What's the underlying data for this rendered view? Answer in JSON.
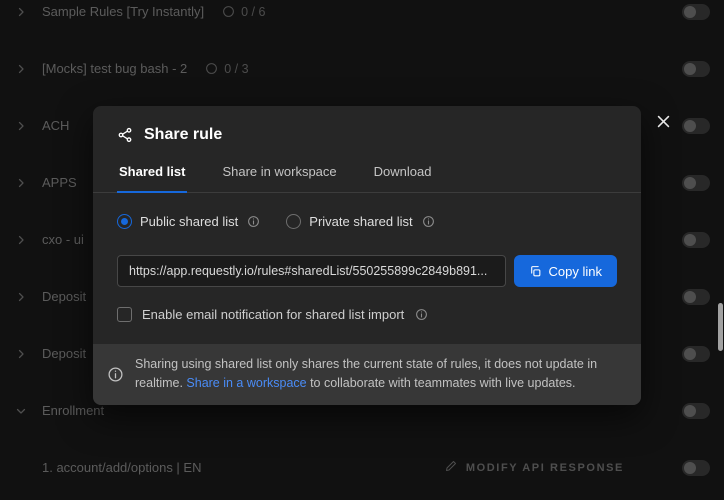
{
  "colors": {
    "accent_blue": "#1668dc",
    "link_blue": "#4a8cf7",
    "modal_bg": "#262626",
    "footer_bg": "#373737"
  },
  "rules_list": {
    "rows": [
      {
        "name": "Sample Rules [Try Instantly]",
        "count": "0 / 6"
      },
      {
        "name": "[Mocks] test bug bash - 2",
        "count": "0 / 3"
      },
      {
        "name": "ACH"
      },
      {
        "name": "APPS"
      },
      {
        "name": "cxo - ui"
      },
      {
        "name": "Deposit"
      },
      {
        "name": "Deposit"
      },
      {
        "name": "Enrollment"
      }
    ],
    "child_row": {
      "name": "1. account/add/options | EN",
      "action_label": "MODIFY API RESPONSE"
    }
  },
  "modal": {
    "title": "Share rule",
    "tabs": [
      {
        "label": "Shared list"
      },
      {
        "label": "Share in workspace"
      },
      {
        "label": "Download"
      }
    ],
    "radios": [
      {
        "label": "Public shared list"
      },
      {
        "label": "Private shared list"
      }
    ],
    "link_value": "https://app.requestly.io/rules#sharedList/550255899c2849b891...",
    "copy_button_label": "Copy link",
    "checkbox_label": "Enable email notification for shared list import",
    "note": {
      "text_before": "Sharing using shared list only shares the current state of rules, it does not update in realtime. ",
      "link_text": "Share in a workspace",
      "text_after": " to collaborate with teammates with live updates."
    }
  }
}
